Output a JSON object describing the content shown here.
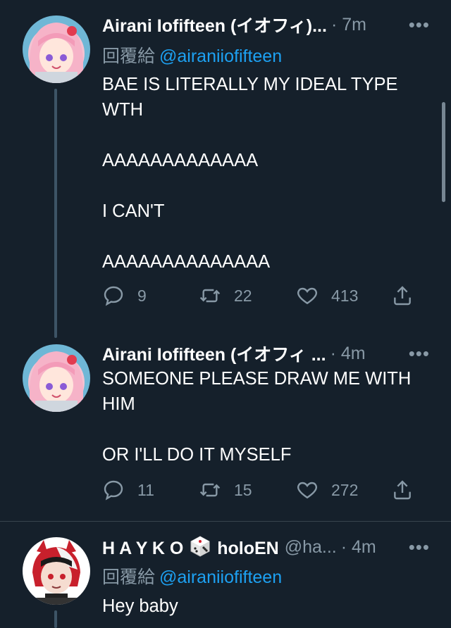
{
  "tweets": [
    {
      "author": "Airani Iofifteen (イオフィ)...",
      "handle": "",
      "time": "· 7m",
      "reply_prefix": "回覆給",
      "reply_to": "@airaniiofifteen",
      "text": "BAE IS LITERALLY MY IDEAL TYPE WTH\n\nAAAAAAAAAAAAA\n\nI CAN'T\n\nAAAAAAAAAAAAAA",
      "replies": "9",
      "retweets": "22",
      "likes": "413"
    },
    {
      "author": "Airani Iofifteen (イオフィ ...",
      "handle": "",
      "time": "· 4m",
      "text": "SOMEONE PLEASE DRAW ME WITH HIM\n\nOR I'LL DO IT MYSELF",
      "replies": "11",
      "retweets": "15",
      "likes": "272"
    },
    {
      "author_prefix": "H A Y K O",
      "author_suffix": "holoEN",
      "handle": "@ha...",
      "time": "· 4m",
      "reply_prefix": "回覆給",
      "reply_to": "@airaniiofifteen",
      "text": "Hey baby"
    }
  ],
  "icons": {
    "more": "more-options-icon",
    "reply": "reply-icon",
    "retweet": "retweet-icon",
    "like": "heart-icon",
    "share": "share-icon",
    "dice": "dice-emoji-icon"
  },
  "colors": {
    "background": "#15202b",
    "secondary_text": "#8899a6",
    "link": "#1da1f2",
    "divider": "#38444d"
  }
}
